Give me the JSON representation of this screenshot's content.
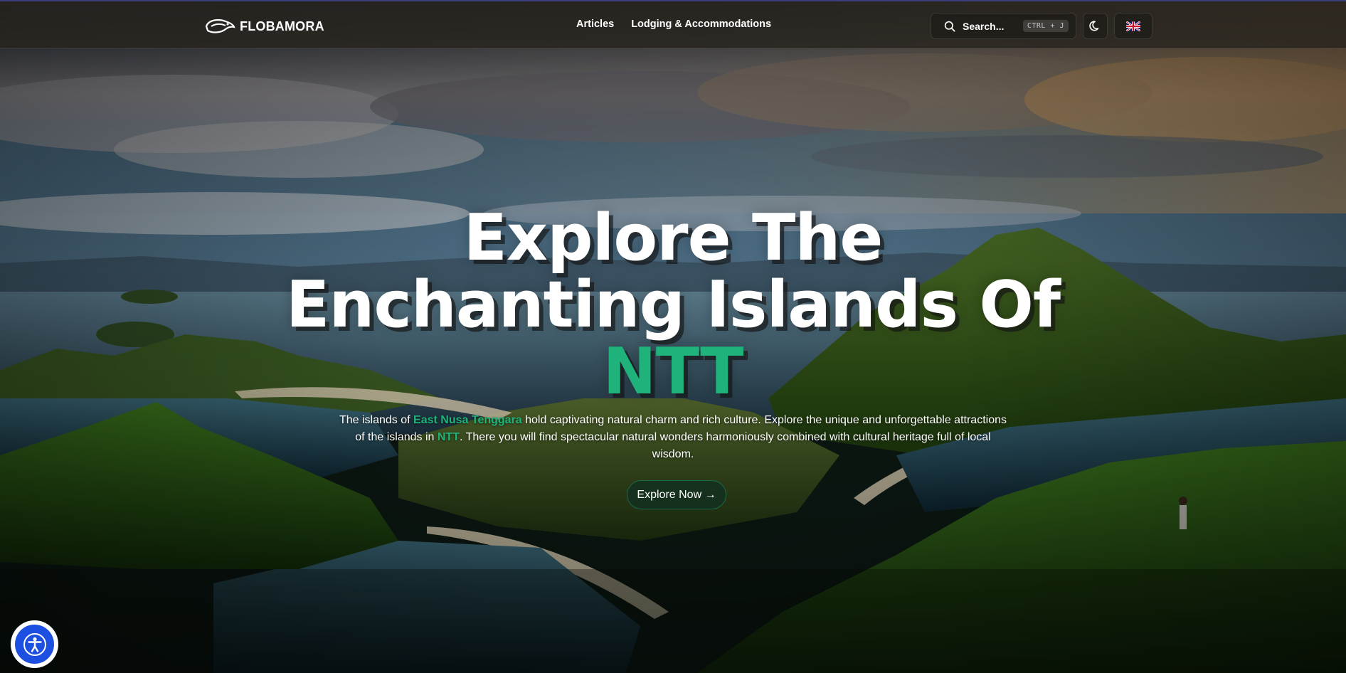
{
  "header": {
    "brand": "FLOBAMORA",
    "nav": [
      {
        "label": "Articles"
      },
      {
        "label": "Lodging & Accommodations"
      }
    ],
    "search": {
      "label": "Search...",
      "shortcut": "CTRL + J"
    },
    "theme_icon": "moon-icon",
    "language_icon": "uk-flag-icon"
  },
  "hero": {
    "title_line1": "Explore The",
    "title_line2": "Enchanting Islands Of",
    "title_accent": "NTT",
    "desc_part1": "The islands of ",
    "desc_highlight1": "East Nusa Tenggara",
    "desc_part2": " hold captivating natural charm and rich culture. Explore the unique and unforgettable attractions of the islands in ",
    "desc_highlight2": "NTT",
    "desc_part3": ". There you will find spectacular natural wonders harmoniously combined with cultural heritage full of local wisdom.",
    "cta_label": "Explore Now →"
  },
  "accessibility": {
    "icon": "accessibility-icon"
  },
  "colors": {
    "accent": "#1fb27a",
    "header_bg": "#28241e",
    "a11y_blue": "#1d4fe0"
  }
}
